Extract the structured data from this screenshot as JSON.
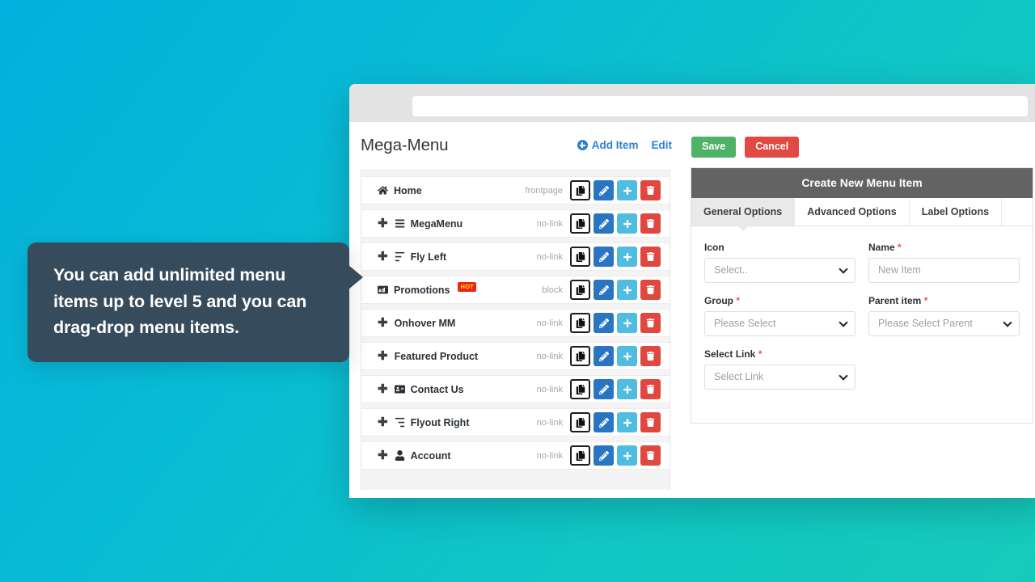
{
  "browser": {
    "traffic_lights": [
      "red",
      "yellow",
      "green"
    ],
    "url_value": ""
  },
  "menu_panel": {
    "title": "Mega-Menu",
    "actions": [
      {
        "label": "Add Item",
        "icon": "plus-circle-icon"
      },
      {
        "label": "Edit",
        "icon": ""
      }
    ],
    "items": [
      {
        "name": "Home",
        "icon": "home-icon",
        "type": "frontpage",
        "indent": 0,
        "draggable": false,
        "badge": ""
      },
      {
        "name": "MegaMenu",
        "icon": "bars-icon",
        "type": "no-link",
        "indent": 1,
        "draggable": true,
        "badge": ""
      },
      {
        "name": "Fly Left",
        "icon": "align-left-icon",
        "type": "no-link",
        "indent": 1,
        "draggable": true,
        "badge": ""
      },
      {
        "name": "Promotions",
        "icon": "ad-icon",
        "type": "block",
        "indent": 0,
        "draggable": false,
        "badge": "HOT"
      },
      {
        "name": "Onhover MM",
        "icon": "",
        "type": "no-link",
        "indent": 1,
        "draggable": true,
        "badge": ""
      },
      {
        "name": "Featured Product",
        "icon": "",
        "type": "no-link",
        "indent": 1,
        "draggable": true,
        "badge": ""
      },
      {
        "name": "Contact Us",
        "icon": "address-card-icon",
        "type": "no-link",
        "indent": 1,
        "draggable": true,
        "badge": ""
      },
      {
        "name": "Flyout Right",
        "icon": "align-right-icon",
        "type": "no-link",
        "indent": 1,
        "draggable": true,
        "badge": ""
      },
      {
        "name": "Account",
        "icon": "user-icon",
        "type": "no-link",
        "indent": 1,
        "draggable": true,
        "badge": ""
      }
    ],
    "row_buttons": [
      {
        "name": "copy-button",
        "icon": "copy-icon"
      },
      {
        "name": "edit-button",
        "icon": "pencil-icon"
      },
      {
        "name": "add-button",
        "icon": "plus-icon"
      },
      {
        "name": "delete-button",
        "icon": "trash-icon"
      }
    ]
  },
  "form_panel": {
    "save_label": "Save",
    "cancel_label": "Cancel",
    "panel_title": "Create New Menu Item",
    "tabs": [
      {
        "label": "General Options",
        "active": true
      },
      {
        "label": "Advanced Options",
        "active": false
      },
      {
        "label": "Label Options",
        "active": false
      }
    ],
    "fields": [
      {
        "label": "Icon",
        "required": false,
        "value": "Select..",
        "control": "select"
      },
      {
        "label": "Name",
        "required": true,
        "value": "New Item",
        "control": "input"
      },
      {
        "label": "Group",
        "required": true,
        "value": "Please Select",
        "control": "select"
      },
      {
        "label": "Parent item",
        "required": true,
        "value": "Please Select Parent",
        "control": "select"
      },
      {
        "label": "Select Link",
        "required": true,
        "value": "Select Link",
        "control": "select"
      }
    ]
  },
  "callout": {
    "text": "You can add unlimited menu items up to level 5 and you can drag-drop menu items."
  },
  "colors": {
    "accent_blue": "#2e7fd4",
    "save_green": "#4eb366",
    "cancel_red": "#e04a43",
    "edit_blue": "#2a74c4",
    "add_cyan": "#4fbce0",
    "delete_red": "#e0483f",
    "panel_header_gray": "#636363",
    "callout_bg": "#364b5c",
    "badge_bg": "#e9261c",
    "badge_text": "#fbe702",
    "bg_gradient_from": "#04b0dd",
    "bg_gradient_to": "#16cabb"
  }
}
